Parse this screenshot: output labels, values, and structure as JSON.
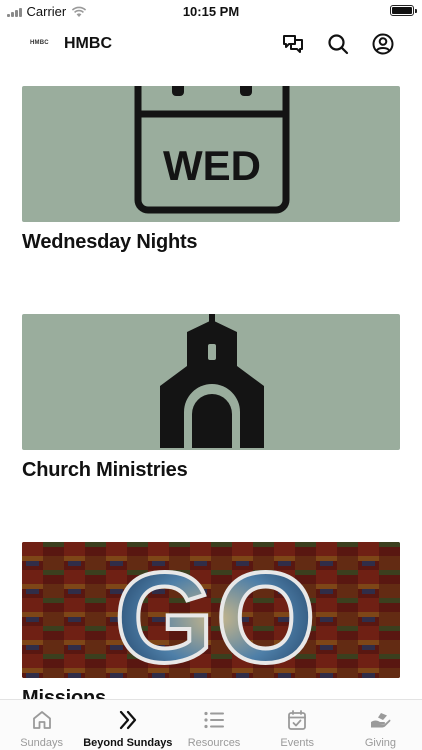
{
  "status_bar": {
    "carrier": "Carrier",
    "time": "10:15 PM"
  },
  "header": {
    "logo_text": "HMBC",
    "title": "HMBC"
  },
  "cards": [
    {
      "title": "Wednesday Nights",
      "image_text": "WED",
      "image_bg": "#9aad9d"
    },
    {
      "title": "Church Ministries",
      "image_bg": "#9aad9d"
    },
    {
      "title": "Missions",
      "image_text": "GO"
    }
  ],
  "tabs": [
    {
      "label": "Sundays",
      "icon": "home-icon",
      "active": false
    },
    {
      "label": "Beyond Sundays",
      "icon": "double-chevron-icon",
      "active": true
    },
    {
      "label": "Resources",
      "icon": "list-icon",
      "active": false
    },
    {
      "label": "Events",
      "icon": "calendar-check-icon",
      "active": false
    },
    {
      "label": "Giving",
      "icon": "giving-hand-icon",
      "active": false
    }
  ],
  "colors": {
    "accent": "#111111",
    "inactive": "#9a9a9a",
    "card_bg": "#9aad9d"
  }
}
